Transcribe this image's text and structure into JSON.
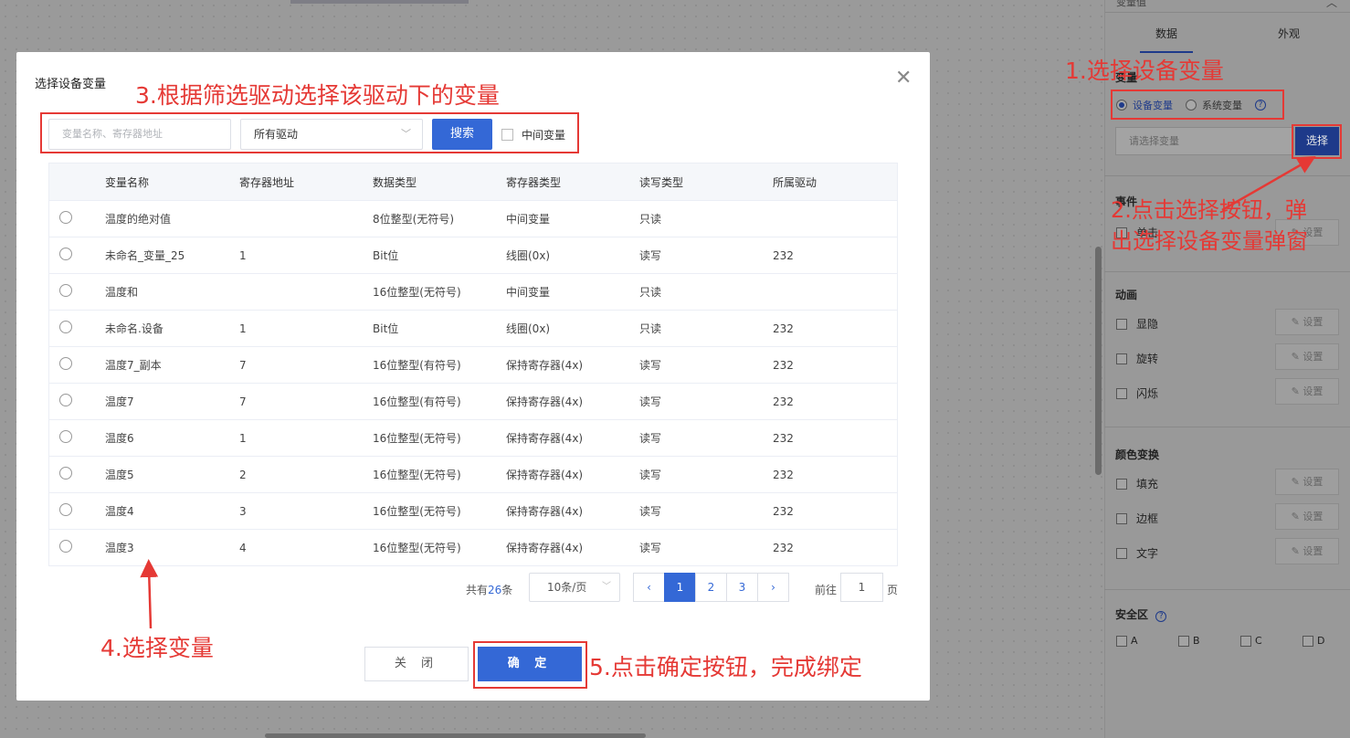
{
  "panel": {
    "header_title": "变量值",
    "collapse_icon": "chevron-up-icon",
    "tabs": [
      "数据",
      "外观"
    ],
    "variable_section_title": "变量",
    "radio_device": "设备变量",
    "radio_system": "系统变量",
    "help_icon": "question-circle-icon",
    "variable_placeholder": "请选择变量",
    "choose_button": "选择",
    "event_title": "事件",
    "event_click": "单击",
    "animation_title": "动画",
    "anim_items": [
      "显隐",
      "旋转",
      "闪烁"
    ],
    "set_label": "设置",
    "color_title": "颜色变换",
    "color_items": [
      "填充",
      "边框",
      "文字"
    ],
    "safe_title": "安全区",
    "safe_items": [
      "A",
      "B",
      "C",
      "D"
    ]
  },
  "dialog": {
    "title": "选择设备变量",
    "close_icon": "close-icon",
    "search_placeholder": "变量名称、寄存器地址",
    "driver_value": "所有驱动",
    "search_button": "搜索",
    "middle_var_label": "中间变量",
    "columns": [
      "变量名称",
      "寄存器地址",
      "数据类型",
      "寄存器类型",
      "读写类型",
      "所属驱动"
    ],
    "rows": [
      [
        "温度的绝对值",
        "",
        "8位整型(无符号)",
        "中间变量",
        "只读",
        ""
      ],
      [
        "未命名_变量_25",
        "1",
        "Bit位",
        "线圈(0x)",
        "读写",
        "232"
      ],
      [
        "温度和",
        "",
        "16位整型(无符号)",
        "中间变量",
        "只读",
        ""
      ],
      [
        "未命名.设备",
        "1",
        "Bit位",
        "线圈(0x)",
        "只读",
        "232"
      ],
      [
        "温度7_副本",
        "7",
        "16位整型(有符号)",
        "保持寄存器(4x)",
        "读写",
        "232"
      ],
      [
        "温度7",
        "7",
        "16位整型(有符号)",
        "保持寄存器(4x)",
        "读写",
        "232"
      ],
      [
        "温度6",
        "1",
        "16位整型(无符号)",
        "保持寄存器(4x)",
        "读写",
        "232"
      ],
      [
        "温度5",
        "2",
        "16位整型(无符号)",
        "保持寄存器(4x)",
        "读写",
        "232"
      ],
      [
        "温度4",
        "3",
        "16位整型(无符号)",
        "保持寄存器(4x)",
        "读写",
        "232"
      ],
      [
        "温度3",
        "4",
        "16位整型(无符号)",
        "保持寄存器(4x)",
        "读写",
        "232"
      ]
    ],
    "total_prefix": "共有",
    "total_count": "26",
    "total_suffix": "条",
    "page_size": "10条/页",
    "pages": [
      "1",
      "2",
      "3"
    ],
    "current_page": "1",
    "goto_label": "前往",
    "goto_value": "1",
    "goto_unit": "页",
    "close_button": "关 闭",
    "ok_button": "确 定"
  },
  "annotations": {
    "step1": "1.选择设备变量",
    "step2_line1": "2.点击选择按钮，弹",
    "step2_line2": "出选择设备变量弹窗",
    "step3": "3.根据筛选驱动选择该驱动下的变量",
    "step4": "4.选择变量",
    "step5": "5.点击确定按钮，完成绑定"
  },
  "colors": {
    "primary": "#3468d6",
    "annotation": "#e53935",
    "overlay": "#9a9a9a"
  }
}
